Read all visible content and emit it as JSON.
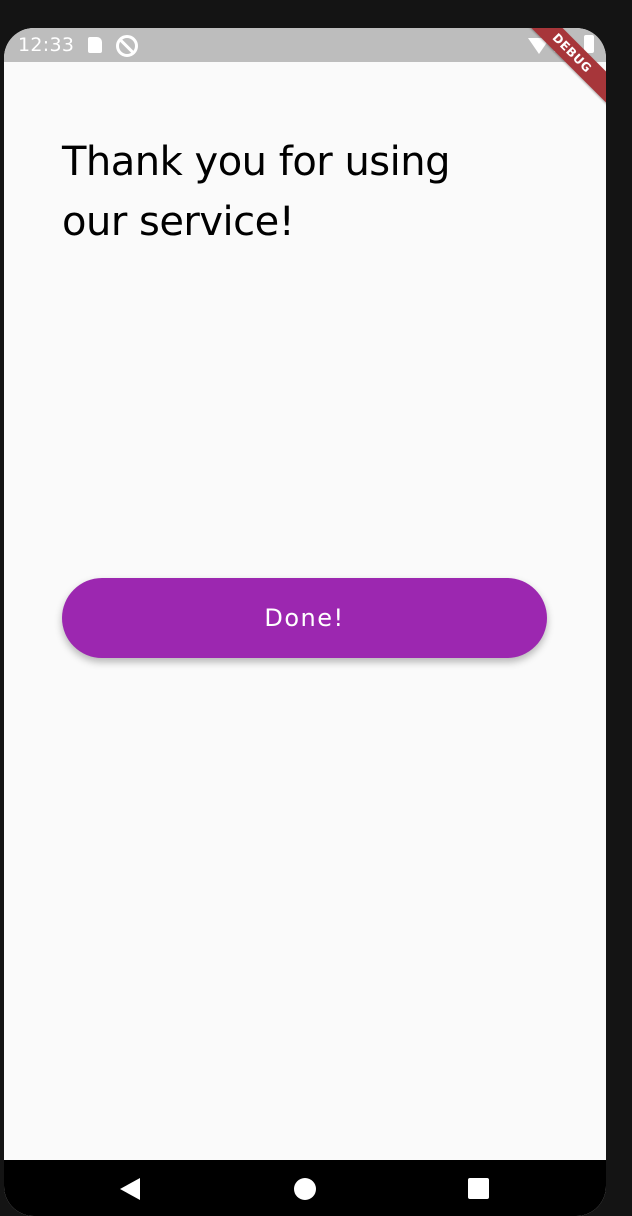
{
  "status_bar": {
    "time": "12:33",
    "icons": [
      "sd-card-icon",
      "sync-disabled-icon",
      "wifi-icon",
      "signal-icon",
      "battery-icon"
    ]
  },
  "debug_banner": "DEBUG",
  "main": {
    "title": "Thank you for using our service!",
    "done_button_label": "Done!"
  },
  "nav_bar": {
    "icons": [
      "back-icon",
      "home-icon",
      "recents-icon"
    ]
  },
  "colors": {
    "accent": "#9c27b0",
    "status_bar": "#bdbdbd",
    "background": "#fafafa",
    "debug_banner": "#a7363a"
  }
}
